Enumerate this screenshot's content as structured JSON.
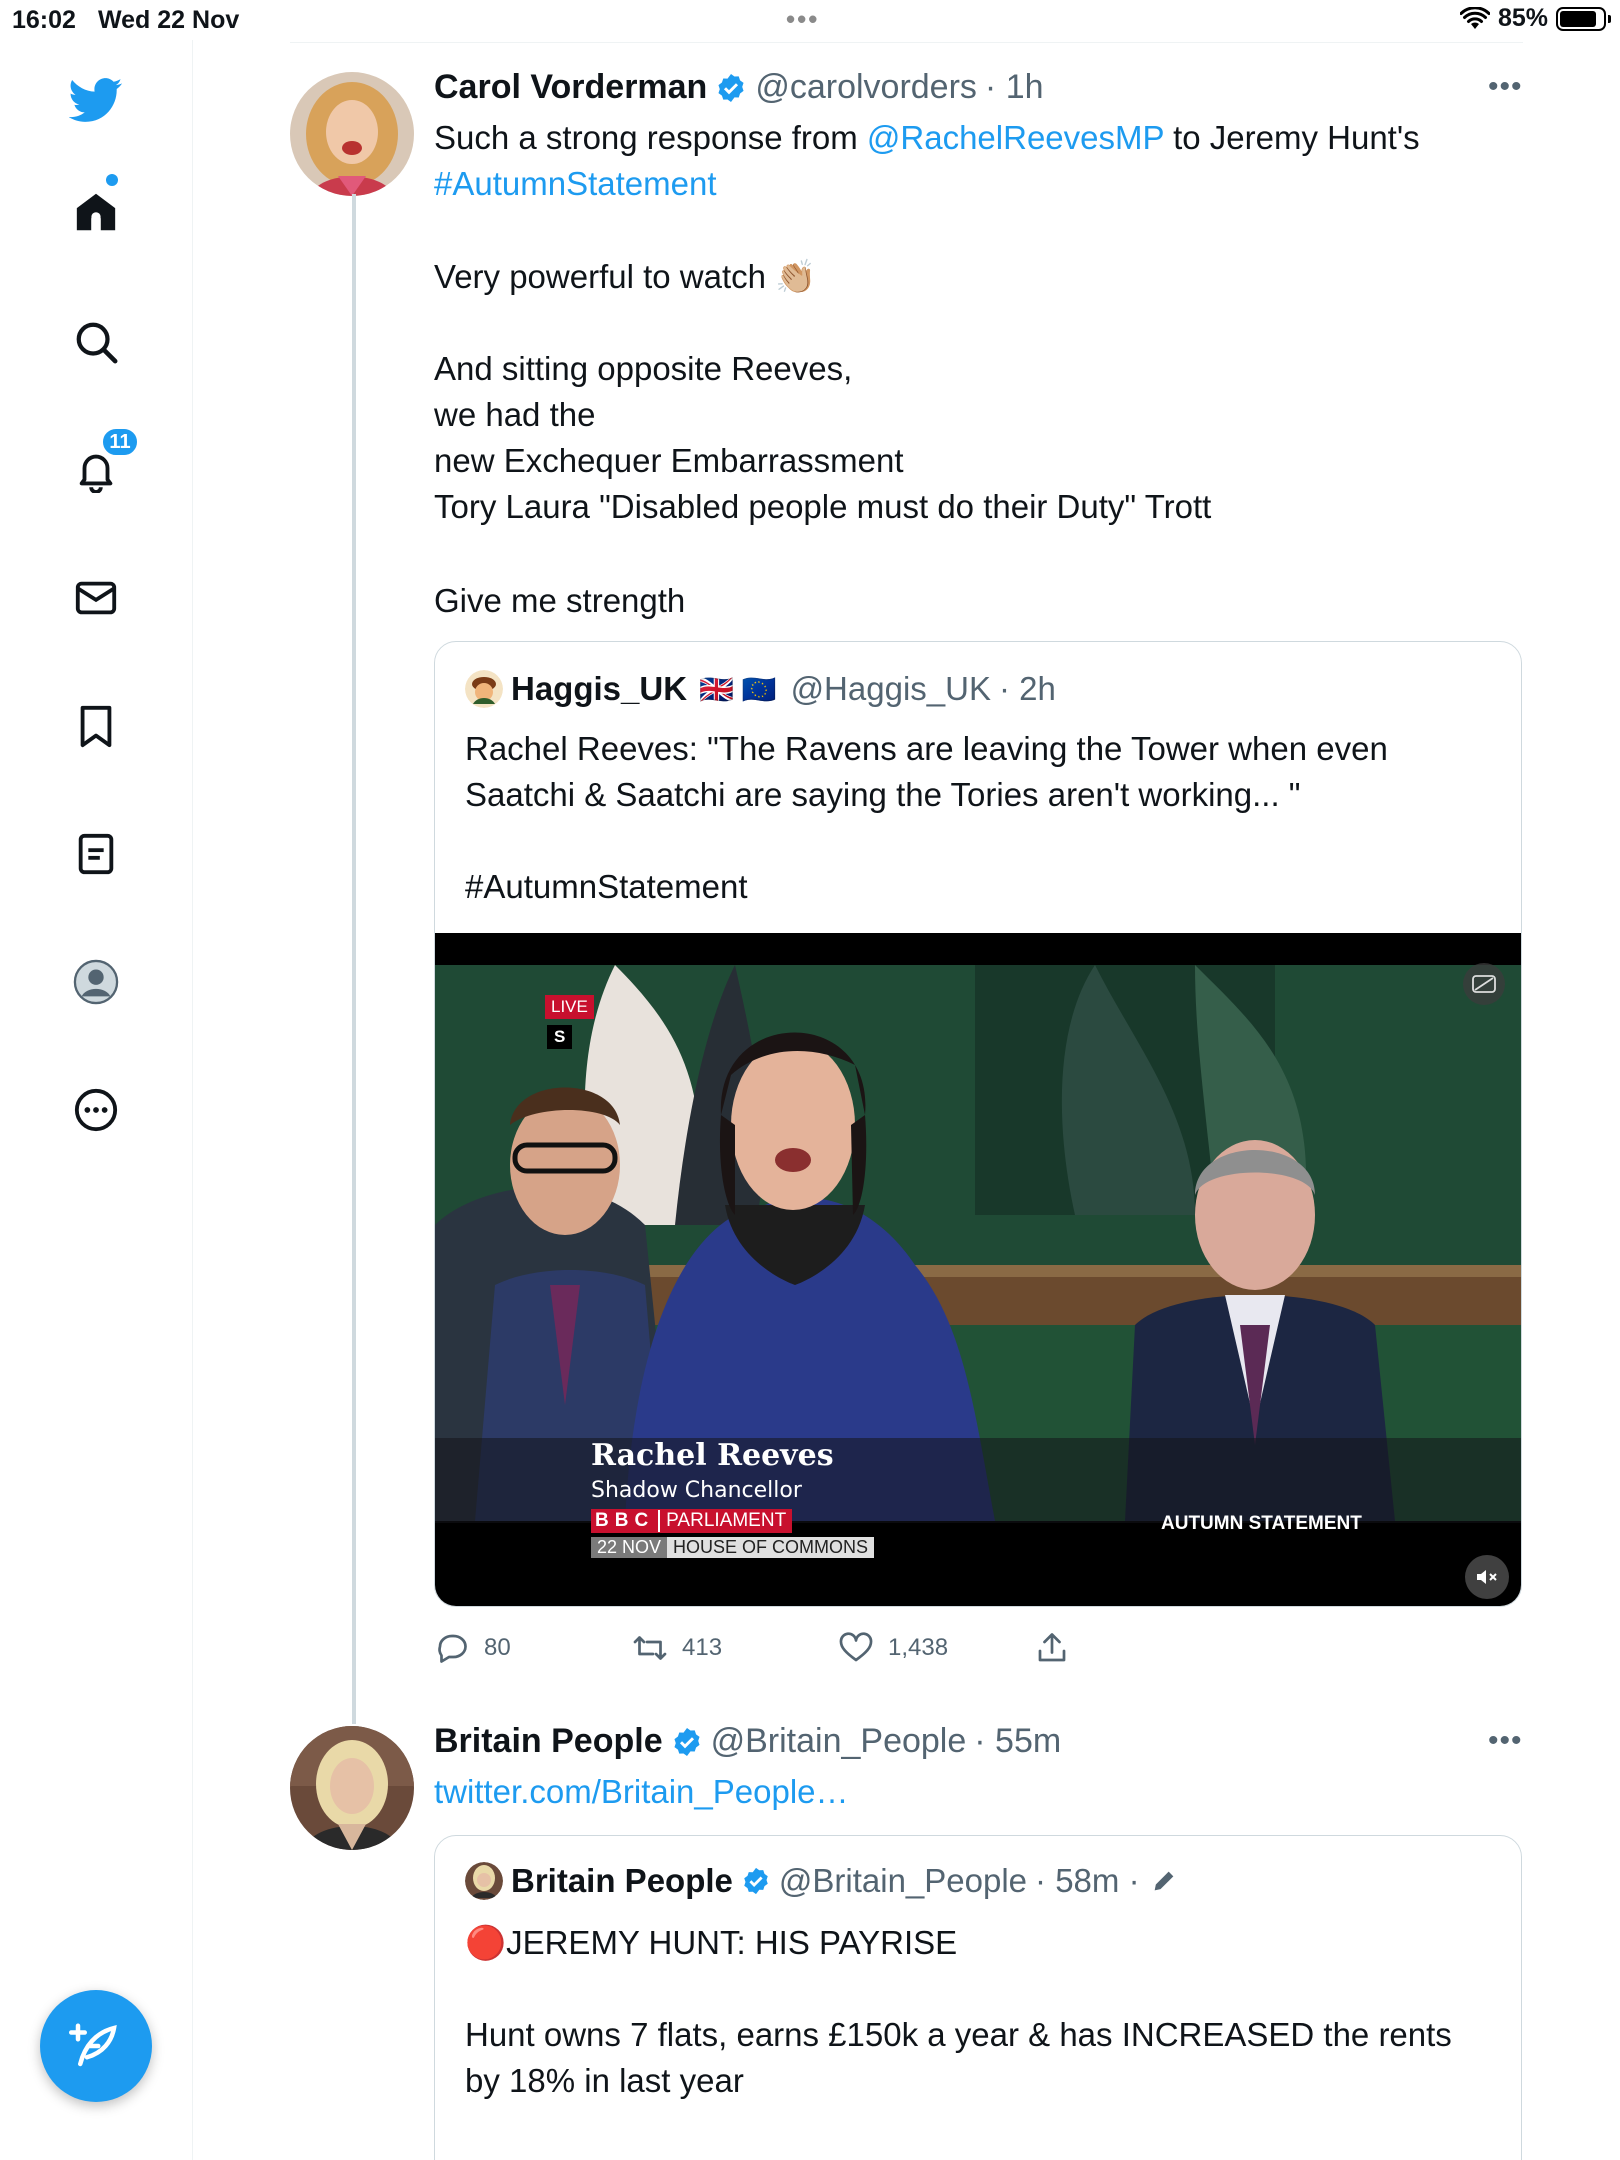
{
  "status_bar": {
    "time": "16:02",
    "date": "Wed 22 Nov",
    "battery": "85%",
    "battery_level": 0.85
  },
  "sidebar": {
    "notifications_count": "11",
    "items": [
      {
        "name": "twitter-logo",
        "icon": "bird-icon"
      },
      {
        "name": "home",
        "icon": "home-icon"
      },
      {
        "name": "explore",
        "icon": "search-icon"
      },
      {
        "name": "notifications",
        "icon": "bell-icon"
      },
      {
        "name": "messages",
        "icon": "mail-icon"
      },
      {
        "name": "bookmarks",
        "icon": "bookmark-icon"
      },
      {
        "name": "lists",
        "icon": "list-icon"
      },
      {
        "name": "profile",
        "icon": "profile-icon"
      },
      {
        "name": "more",
        "icon": "more-circle-icon"
      }
    ]
  },
  "tweet1": {
    "name": "Carol Vorderman",
    "handle": "@carolvorders",
    "time": "· 1h",
    "text_line1_pre": "Such a strong response from ",
    "mention": "@RachelReevesMP",
    "text_line1_post": " to Jeremy Hunt's",
    "hashtag": "#AutumnStatement",
    "para2": "Very powerful to watch 👏🏼",
    "para3": "And sitting opposite Reeves,\nwe had the\nnew Exchequer Embarrassment\nTory Laura \"Disabled people must do their Duty\" Trott",
    "para4": "Give me strength",
    "quote": {
      "name": "Haggis_UK",
      "flags": "🇬🇧 🇪🇺",
      "handle": "@Haggis_UK",
      "time": "· 2h",
      "text": "Rachel Reeves: \"The Ravens are leaving the Tower when even\nSaatchi & Saatchi are saying the Tories aren't working... \"",
      "hashtag": "#AutumnStatement",
      "video": {
        "live_label": "LIVE",
        "channel_letter": "S",
        "caption_name": "Rachel Reeves",
        "caption_role": "Shadow Chancellor",
        "bbc": "BBC",
        "parliament": "PARLIAMENT",
        "date_tag": "22 NOV",
        "location": "HOUSE OF COMMONS",
        "segment": "AUTUMN STATEMENT"
      }
    },
    "stats": {
      "replies": "80",
      "retweets": "413",
      "likes": "1,438"
    }
  },
  "tweet2": {
    "name": "Britain People",
    "handle": "@Britain_People",
    "time": "· 55m",
    "link": "twitter.com/Britain_People…",
    "quote": {
      "name": "Britain People",
      "handle": "@Britain_People",
      "time": "· 58m ·",
      "line1": "🔴JEREMY HUNT: HIS PAYRISE",
      "line2": "Hunt owns 7 flats, earns £150k a year & has INCREASED the rents\nby 18% in last year"
    }
  },
  "colors": {
    "accent": "#1d9bf0",
    "text": "#0f1419",
    "muted": "#536471",
    "border": "#cfd9de"
  }
}
